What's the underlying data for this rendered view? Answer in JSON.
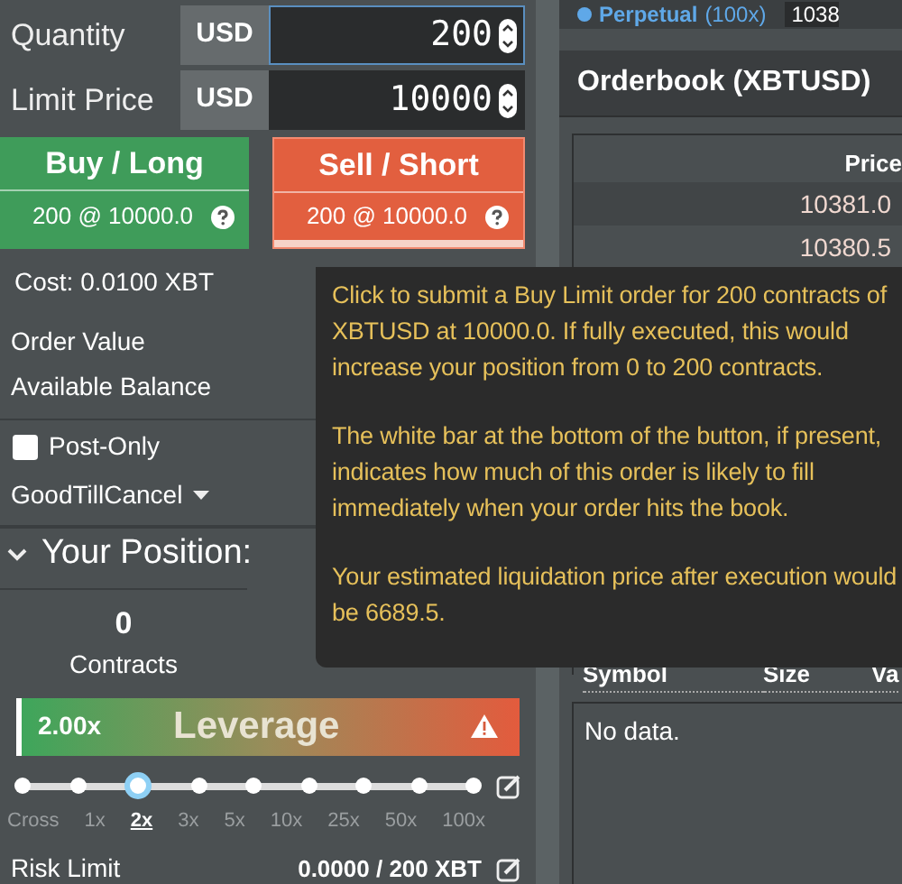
{
  "order_form": {
    "fields": [
      {
        "label": "Quantity",
        "unit": "USD",
        "value": "200",
        "focused": true
      },
      {
        "label": "Limit Price",
        "unit": "USD",
        "value": "10000",
        "focused": false
      }
    ],
    "buttons": [
      {
        "kind": "buy",
        "label": "Buy / Long",
        "detail": "200 @ 10000.0",
        "fill_bar": false
      },
      {
        "kind": "sell",
        "label": "Sell / Short",
        "detail": "200 @ 10000.0",
        "fill_bar": true
      }
    ],
    "cost": "Cost: 0.0100 XBT",
    "order_value_label": "Order Value",
    "available_balance_label": "Available Balance",
    "post_only": {
      "label": "Post-Only",
      "checked": false
    },
    "time_in_force": "GoodTillCancel"
  },
  "position": {
    "title": "Your Position:",
    "contracts": "0",
    "contracts_label": "Contracts",
    "leverage_value": "2.00x",
    "leverage_label": "Leverage",
    "stops": [
      {
        "label": "Cross",
        "selected": false
      },
      {
        "label": "1x",
        "selected": false
      },
      {
        "label": "2x",
        "selected": true
      },
      {
        "label": "3x",
        "selected": false
      },
      {
        "label": "5x",
        "selected": false
      },
      {
        "label": "10x",
        "selected": false
      },
      {
        "label": "25x",
        "selected": false
      },
      {
        "label": "50x",
        "selected": false
      },
      {
        "label": "100x",
        "selected": false
      }
    ],
    "risk_limit_label": "Risk Limit",
    "risk_limit_value": "0.0000 / 200 XBT"
  },
  "ticker": {
    "name": "Perpetual",
    "leverage": "(100x)",
    "price": "1038"
  },
  "orderbook": {
    "title": "Orderbook (XBTUSD)",
    "price_header": "Price",
    "rows": [
      "10381.0",
      "10380.5"
    ]
  },
  "positions_table": {
    "columns": [
      "Symbol",
      "Size",
      "Va"
    ],
    "empty": "No data."
  },
  "tooltip": {
    "paragraphs": [
      "Click to submit a Buy Limit order for 200 contracts of XBTUSD at 10000.0. If fully executed, this would increase your position from 0 to 200 contracts.",
      "The white bar at the bottom of the button, if present, indicates how much of this order is likely to fill immediately when your order hits the book.",
      "Your estimated liquidation price after execution would be 6689.5."
    ]
  }
}
